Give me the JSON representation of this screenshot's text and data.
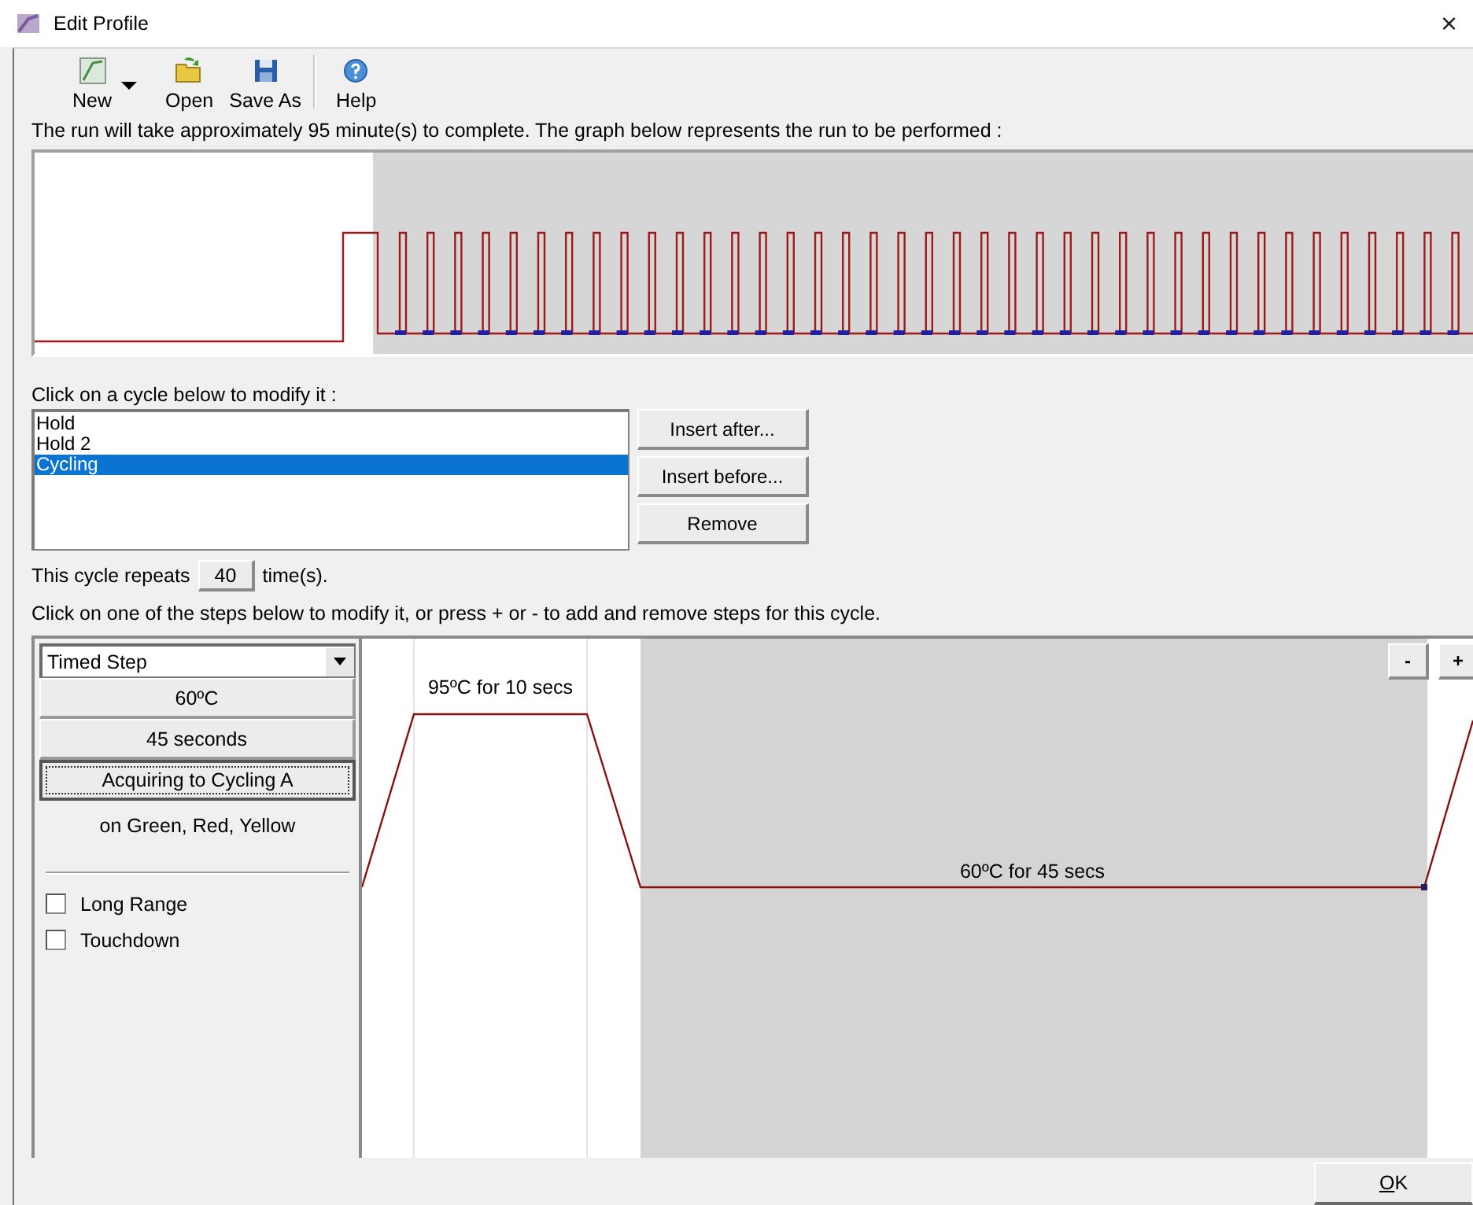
{
  "window": {
    "title": "Edit Profile",
    "close": "×"
  },
  "toolbar": [
    {
      "label": "New",
      "kind": "new",
      "has_menu": true
    },
    {
      "label": "Open",
      "kind": "open",
      "has_menu": false
    },
    {
      "label": "Save As",
      "kind": "save",
      "has_menu": false
    },
    {
      "label": "Help",
      "kind": "help",
      "has_menu": false
    }
  ],
  "summary": "The run will take approximately 95 minute(s) to complete. The graph below represents the run to be performed :",
  "cycles_prompt": "Click on a cycle below to modify it :",
  "cycles": [
    {
      "name": "Hold",
      "selected": false
    },
    {
      "name": "Hold 2",
      "selected": false
    },
    {
      "name": "Cycling",
      "selected": true
    }
  ],
  "cycle_buttons": [
    "Insert after...",
    "Insert before...",
    "Remove"
  ],
  "repeats": {
    "label": "This cycle repeats",
    "value": "40",
    "unit": "time(s)."
  },
  "steps_prompt": "Click on one of the steps below to modify it, or press + or - to add and remove steps for this cycle.",
  "step_editor": {
    "type": "Timed Step",
    "temperature": "60ºC",
    "duration": "45 seconds",
    "acquiring": "Acquiring to Cycling A",
    "channels": "on Green, Red, Yellow",
    "options": [
      {
        "label": "Long Range",
        "checked": false
      },
      {
        "label": "Touchdown",
        "checked": false
      }
    ]
  },
  "steps": [
    {
      "label": "95ºC for 10 secs",
      "selected": false
    },
    {
      "label": "60ºC for 45 secs",
      "selected": true
    }
  ],
  "step_buttons": [
    "-",
    "+"
  ],
  "ok": "OK"
}
